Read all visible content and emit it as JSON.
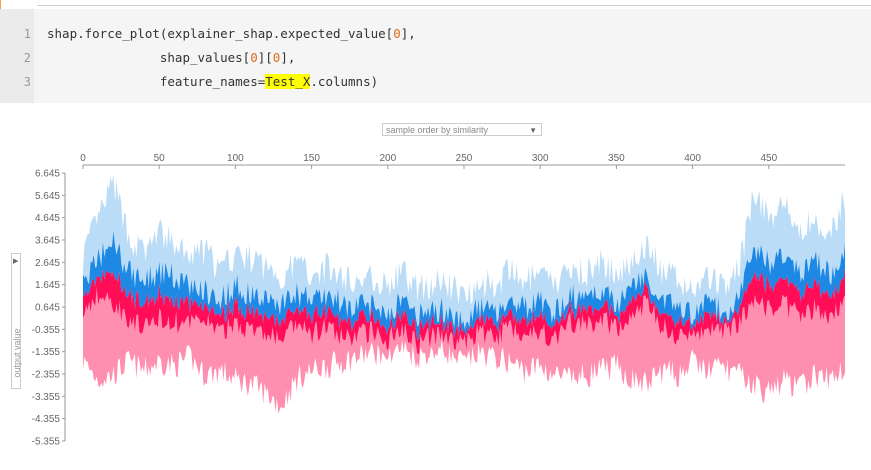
{
  "code_cell": {
    "line_numbers": [
      "1",
      "2",
      "3"
    ],
    "line1": {
      "a": "shap.force_plot(explainer_shap.expected_value[",
      "b": "0",
      "c": "],"
    },
    "line2": {
      "a": "               shap_values[",
      "b": "0",
      "c": "][",
      "d": "0",
      "e": "],"
    },
    "line3": {
      "a": "               feature_names=",
      "b": "Test_X",
      "c": ".columns)"
    }
  },
  "controls": {
    "sort_select": "sample order by similarity",
    "y_select": "output value"
  },
  "chart_data": {
    "type": "area",
    "title": "",
    "xlabel": "",
    "ylabel": "output value",
    "xlim": [
      0,
      500
    ],
    "ylim": [
      -5.355,
      6.645
    ],
    "x_ticks": [
      "0",
      "50",
      "100",
      "150",
      "200",
      "250",
      "300",
      "350",
      "400",
      "450"
    ],
    "y_ticks": [
      "6.645",
      "5.645",
      "4.645",
      "3.645",
      "2.645",
      "1.645",
      "0.645",
      "-0.355",
      "-1.355",
      "-2.355",
      "-3.355",
      "-4.355",
      "-5.355"
    ],
    "colors": {
      "positive": "#ff0d57",
      "positive_light": "#ff8fb0",
      "negative": "#1e88e5",
      "negative_light": "#bbdcf7"
    },
    "series": [
      {
        "name": "",
        "values_x": [
          0,
          10,
          20,
          30,
          40,
          50,
          60,
          70,
          80,
          90,
          100,
          110,
          120,
          130,
          140,
          150,
          160,
          170,
          180,
          190,
          200,
          210,
          220,
          230,
          240,
          250,
          260,
          270,
          280,
          290,
          300,
          310,
          320,
          330,
          340,
          350,
          360,
          370,
          380,
          390,
          400,
          410,
          420,
          430,
          440,
          450,
          460,
          470,
          480,
          490,
          500
        ],
        "top": [
          3.0,
          4.6,
          6.2,
          3.8,
          3.0,
          4.0,
          3.4,
          2.8,
          3.2,
          2.2,
          3.0,
          2.8,
          2.4,
          2.0,
          2.6,
          2.2,
          2.4,
          2.0,
          1.8,
          2.0,
          1.6,
          2.2,
          1.4,
          1.8,
          1.6,
          1.2,
          1.8,
          1.6,
          2.2,
          1.8,
          2.0,
          1.6,
          2.4,
          2.2,
          2.6,
          2.0,
          2.8,
          3.4,
          2.2,
          1.8,
          1.4,
          2.0,
          1.6,
          2.2,
          5.6,
          4.8,
          5.2,
          4.0,
          4.6,
          3.6,
          5.6
        ],
        "mid_hi": [
          1.8,
          2.8,
          3.6,
          2.2,
          1.8,
          2.2,
          2.0,
          1.6,
          1.4,
          1.0,
          1.6,
          1.2,
          1.0,
          0.8,
          1.2,
          1.0,
          1.2,
          0.8,
          0.6,
          0.8,
          0.4,
          1.0,
          0.2,
          0.6,
          0.4,
          0.0,
          0.6,
          0.4,
          1.0,
          0.6,
          0.8,
          0.4,
          1.2,
          1.0,
          1.4,
          0.8,
          1.6,
          2.0,
          1.0,
          0.6,
          0.2,
          0.8,
          0.4,
          1.0,
          3.2,
          2.6,
          3.0,
          2.2,
          2.8,
          2.0,
          3.4
        ],
        "mid_lo": [
          0.4,
          1.2,
          0.8,
          0.2,
          -0.4,
          0.2,
          0.0,
          -0.2,
          0.2,
          -0.6,
          0.0,
          -0.4,
          -0.6,
          -0.8,
          -0.2,
          -0.6,
          -0.2,
          -0.8,
          -0.6,
          -0.4,
          -0.8,
          -0.2,
          -1.0,
          -0.6,
          -0.8,
          -1.0,
          -0.4,
          -0.8,
          -0.2,
          -0.6,
          -0.4,
          -0.8,
          0.0,
          -0.2,
          0.2,
          -0.4,
          0.4,
          0.8,
          -0.2,
          -0.6,
          -0.8,
          -0.2,
          -0.6,
          0.0,
          1.0,
          0.6,
          0.8,
          0.2,
          0.6,
          0.0,
          1.2
        ],
        "bottom": [
          -1.8,
          -2.6,
          -2.4,
          -1.8,
          -2.2,
          -1.8,
          -2.0,
          -1.6,
          -2.4,
          -2.2,
          -2.6,
          -2.8,
          -3.2,
          -3.8,
          -2.6,
          -2.2,
          -2.0,
          -1.8,
          -1.6,
          -1.4,
          -1.4,
          -1.2,
          -1.6,
          -1.2,
          -1.4,
          -1.8,
          -1.4,
          -1.6,
          -1.8,
          -2.2,
          -2.0,
          -2.4,
          -2.6,
          -2.4,
          -2.2,
          -2.0,
          -2.6,
          -2.8,
          -2.2,
          -2.4,
          -1.8,
          -2.2,
          -2.0,
          -2.4,
          -2.8,
          -3.2,
          -2.6,
          -3.0,
          -2.4,
          -2.6,
          -2.0
        ]
      }
    ]
  }
}
